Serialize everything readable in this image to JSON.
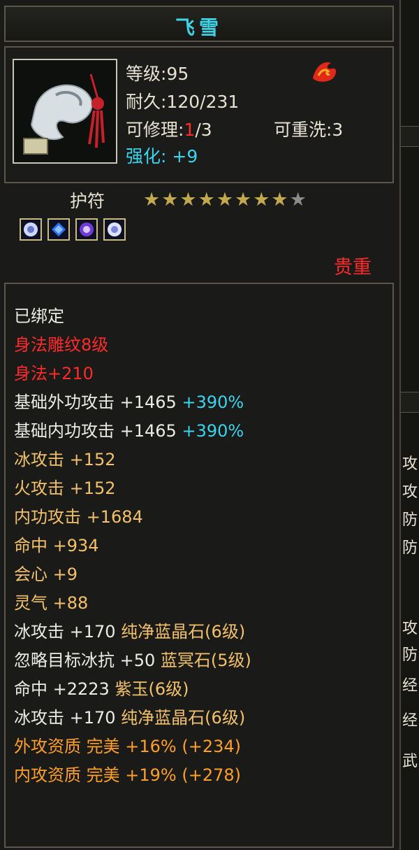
{
  "item": {
    "name": "飞雪",
    "level_text": "等级:95",
    "durability_text": "耐久:120/231",
    "repair_label": "可修理:",
    "repair_current": "1",
    "repair_total": "/3",
    "rewash_text": "可重洗:3",
    "enhance_label": "强化:",
    "enhance_value": "+9",
    "type_label": "护符",
    "stars_filled": 8,
    "stars_total": 9,
    "stars_text": "★★★★★★★★★",
    "gems": [
      "white-gem-icon",
      "blue-gem-icon",
      "purple-gem-icon",
      "white-gem-icon"
    ],
    "rarity": "贵重"
  },
  "attributes": [
    {
      "text": "已绑定",
      "color": "#ecebe6"
    },
    {
      "text": "身法雕纹8级",
      "color": "#ff2a2a"
    },
    {
      "text": "身法+210",
      "color": "#ff2a2a"
    },
    {
      "text": "基础外功攻击  +1465",
      "extra": "+390%",
      "color": "#ecebe6"
    },
    {
      "text": "基础内功攻击  +1465",
      "extra": "+390%",
      "color": "#ecebe6"
    },
    {
      "text": "冰攻击  +152",
      "color": "#f3c06b"
    },
    {
      "text": "火攻击  +152",
      "color": "#f3c06b"
    },
    {
      "text": "内功攻击  +1684",
      "color": "#f3c06b"
    },
    {
      "text": "命中  +934",
      "color": "#f3c06b"
    },
    {
      "text": "会心  +9",
      "color": "#f3c06b"
    },
    {
      "text": "灵气  +88",
      "color": "#f3c06b"
    },
    {
      "text": "冰攻击  +170",
      "gem": "纯净蓝晶石(6级)",
      "color": "#ecebe6"
    },
    {
      "text": "忽略目标冰抗  +50",
      "gem": "蓝冥石(5级)",
      "color": "#ecebe6"
    },
    {
      "text": "命中  +2223",
      "gem": "紫玉(6级)",
      "color": "#ecebe6"
    },
    {
      "text": "冰攻击  +170",
      "gem": "纯净蓝晶石(6级)",
      "color": "#ecebe6"
    },
    {
      "text": "外攻资质  完美  +16%",
      "paren": "(+234)",
      "color": "#ff9f2a"
    },
    {
      "text": "内攻资质  完美  +19%",
      "paren": "(+278)",
      "color": "#ff9f2a"
    }
  ],
  "right_strip": [
    "攻",
    "攻",
    "防",
    "防",
    "攻",
    "防",
    "经",
    "经",
    "武"
  ]
}
